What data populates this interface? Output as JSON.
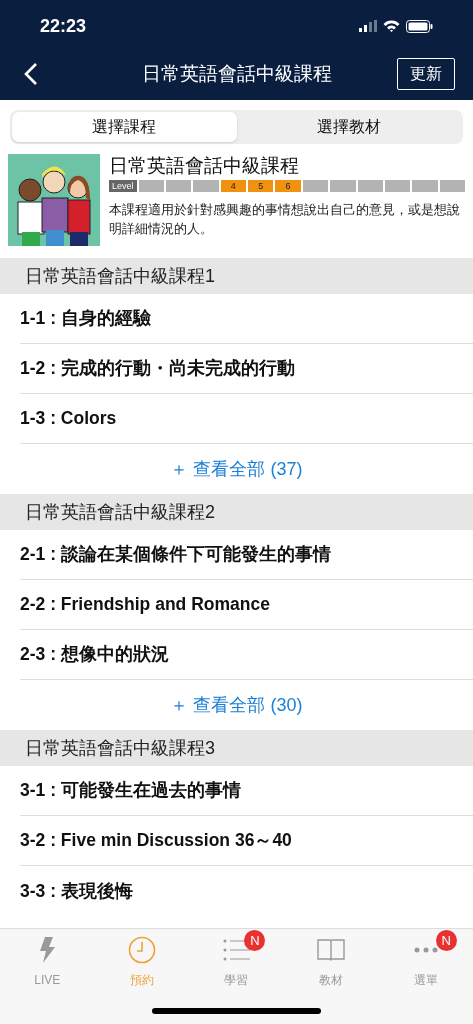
{
  "status_bar": {
    "time": "22:23"
  },
  "nav": {
    "title": "日常英語會話中級課程",
    "action": "更新"
  },
  "segments": [
    {
      "label": "選擇課程",
      "selected": true
    },
    {
      "label": "選擇教材",
      "selected": false
    }
  ],
  "course": {
    "kind": "picture",
    "title": "日常英語會話中級課程",
    "level_label": "Level",
    "levels": [
      {
        "on": false
      },
      {
        "on": false
      },
      {
        "on": false
      },
      {
        "on": true,
        "label": "4"
      },
      {
        "on": true,
        "label": "5"
      },
      {
        "on": true,
        "label": "6"
      },
      {
        "on": false
      },
      {
        "on": false
      },
      {
        "on": false
      },
      {
        "on": false
      },
      {
        "on": false
      },
      {
        "on": false
      }
    ],
    "description": "本課程適用於針對感興趣的事情想說出自己的意見，或是想說明詳細情況的人。"
  },
  "sections": [
    {
      "title": "日常英語會話中級課程1",
      "lessons": [
        "1-1 : 自身的經驗",
        "1-2 : 完成的行動・尚未完成的行動",
        "1-3 : Colors"
      ],
      "view_all": "＋ 查看全部 (37)"
    },
    {
      "title": "日常英語會話中級課程2",
      "lessons": [
        "2-1 : 談論在某個條件下可能發生的事情",
        "2-2 : Friendship and Romance",
        "2-3 : 想像中的狀況"
      ],
      "view_all": "＋ 查看全部 (30)"
    },
    {
      "title": "日常英語會話中級課程3",
      "lessons": [
        "3-1 : 可能發生在過去的事情",
        "3-2 : Five min Discussion 36～40",
        "3-3 : 表現後悔"
      ]
    }
  ],
  "tab_bar": [
    {
      "kind": "live",
      "label": "LIVE",
      "selected": false
    },
    {
      "kind": "clock",
      "label": "預約",
      "selected": true
    },
    {
      "kind": "list",
      "label": "學習",
      "selected": false,
      "badge": "N"
    },
    {
      "kind": "book",
      "label": "教材",
      "selected": false
    },
    {
      "kind": "more",
      "label": "選單",
      "selected": false,
      "badge": "N"
    }
  ]
}
